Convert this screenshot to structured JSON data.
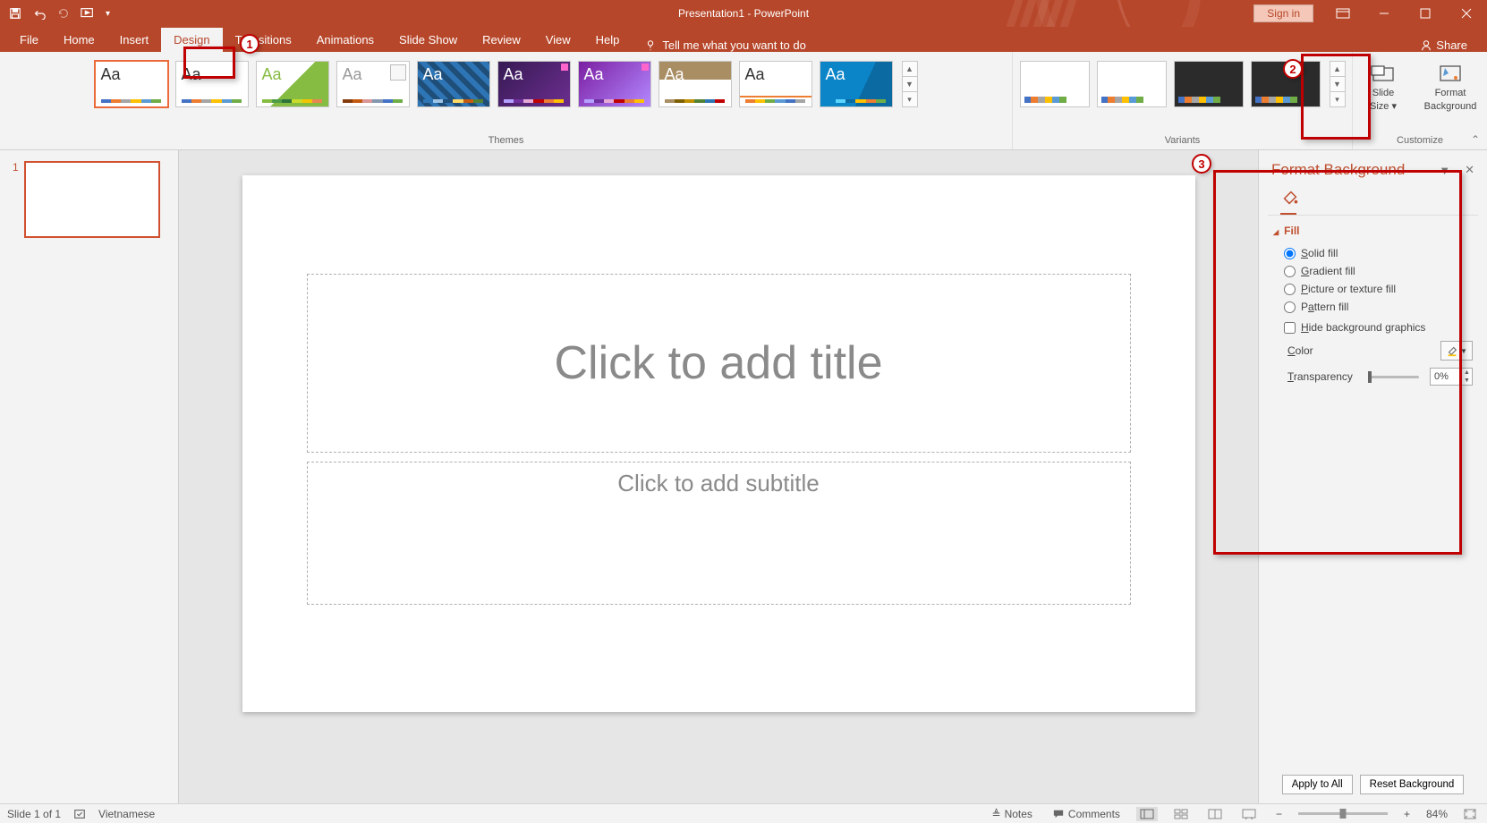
{
  "title": "Presentation1 - PowerPoint",
  "qat_signin": "Sign in",
  "tabs": [
    "File",
    "Home",
    "Insert",
    "Design",
    "Transitions",
    "Animations",
    "Slide Show",
    "Review",
    "View",
    "Help"
  ],
  "active_tab": "Design",
  "tellme_placeholder": "Tell me what you want to do",
  "share_label": "Share",
  "ribbon": {
    "themes_label": "Themes",
    "variants_label": "Variants",
    "customize_label": "Customize",
    "slide_size": "Slide",
    "slide_size2": "Size ▾",
    "format_bg": "Format",
    "format_bg2": "Background"
  },
  "slide_number": "1",
  "placeholders": {
    "title": "Click to add title",
    "subtitle": "Click to add subtitle"
  },
  "pane": {
    "title": "Format Background",
    "section_fill": "Fill",
    "opt_solid": "Solid fill",
    "opt_gradient": "Gradient fill",
    "opt_picture": "Picture or texture fill",
    "opt_pattern": "Pattern fill",
    "chk_hide": "Hide background graphics",
    "lbl_color": "Color",
    "lbl_transparency": "Transparency",
    "transparency_val": "0%",
    "apply_all": "Apply to All",
    "reset": "Reset Background"
  },
  "status": {
    "slide_of": "Slide 1 of 1",
    "lang": "Vietnamese",
    "notes": "Notes",
    "comments": "Comments",
    "zoom": "84%"
  },
  "callouts": {
    "c1": "1",
    "c2": "2",
    "c3": "3"
  }
}
